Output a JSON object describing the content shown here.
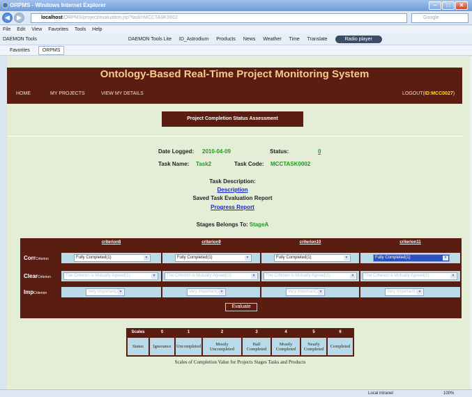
{
  "browser": {
    "title": "ORPMS - Windows Internet Explorer",
    "address_host": "localhost",
    "address_rest": "/ORPMS/project/evaluation.jsp?task=MCCTASK0002",
    "search_placeholder": "Google",
    "menu": [
      "File",
      "Edit",
      "View",
      "Favorites",
      "Tools",
      "Help"
    ],
    "toolbar": [
      "DAEMON Tools",
      "DAEMON Tools Lite",
      "ID_Astrodium",
      "Products",
      "News",
      "Weather",
      "Time",
      "Translate"
    ],
    "radio_label": "Radio player",
    "favorites_label": "Favorites",
    "tab_label": "ORPMS",
    "status_zone": "Local intranet",
    "zoom": "100%"
  },
  "app": {
    "title": "Ontology-Based Real-Time Project Monitoring System",
    "nav": {
      "home": "HOME",
      "my_projects": "MY PROJECTS",
      "view_details": "VIEW MY DETAILS",
      "logout": "LOGOUT(",
      "user_id": "ID:MCC0027",
      "logout_close": ")"
    }
  },
  "assessment": {
    "heading": "Project Completion Status Assessment",
    "date_label": "Date Logged:",
    "date_value": "2010-04-09",
    "status_label": "Status:",
    "status_value": "0",
    "task_name_label": "Task Name:",
    "task_name_value": "Task2",
    "task_code_label": "Task Code:",
    "task_code_value": "MCCTASK0002",
    "task_desc_label": "Task Description:",
    "desc_link": "Description",
    "saved_report_label": "Saved Task Evaluation Report",
    "progress_link": "Progress Report",
    "stage_label": "Stages Belongs To:",
    "stage_value": "StageA"
  },
  "criteria": {
    "columns": [
      "criterion8",
      "criterion9",
      "criterion10",
      "criterion11"
    ],
    "rows": [
      {
        "big": "Corr",
        "small": "Criterion",
        "values": [
          "Fully Completed(1)",
          "Fully Completed(1)",
          "Fully Completed(1)",
          "Fully Completed(1)"
        ]
      },
      {
        "big": "Clear",
        "small": "Criterion",
        "values": [
          "The Criterion is Mutually Agreed(1)",
          "The Criterion is Mutually Agreed(1)",
          "The Criterion is Mutually Agreed(1)",
          "The Criterion is Mutually Agreed(1)"
        ]
      },
      {
        "big": "Imp",
        "small": "Criterion",
        "values": [
          "Very Important(2)",
          "Very Important(2)",
          "Very Important(2)",
          "Very Important(2)"
        ]
      }
    ],
    "evaluate_label": "Evaluate"
  },
  "scales": {
    "header_label": "Scales",
    "numbers": [
      "0",
      "1",
      "2",
      "3",
      "4",
      "5",
      "6"
    ],
    "row_label": "Status",
    "statuses": [
      "Ignorance",
      "Uncompleted",
      "Mostly Uncompleted",
      "Half Completed",
      "Mostly Completed",
      "Nearly Completed",
      "Completed"
    ],
    "caption": "Scales of Completion Value for Projects Stages Tasks and Products"
  }
}
